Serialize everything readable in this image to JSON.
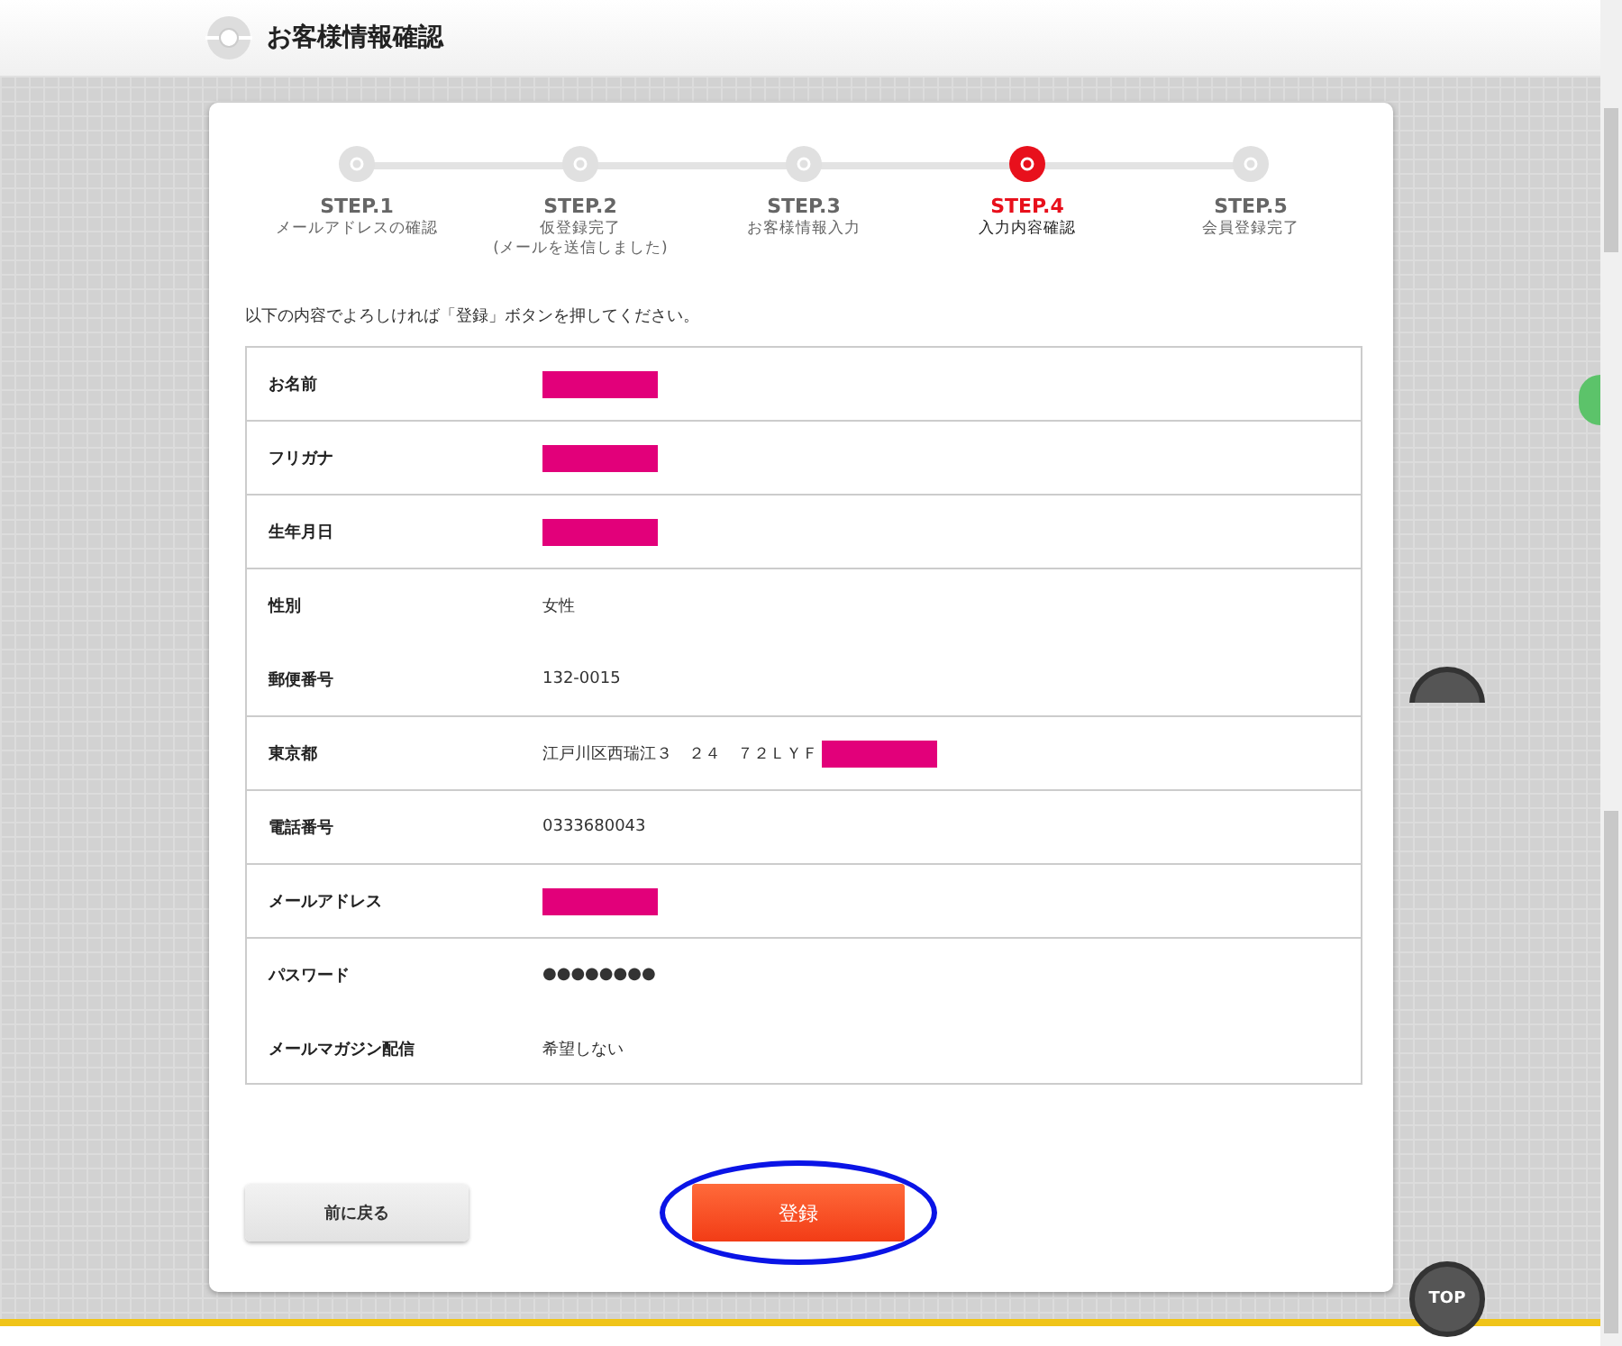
{
  "header": {
    "title": "お客様情報確認"
  },
  "steps": [
    {
      "label": "STEP.1",
      "caption": "メールアドレスの確認",
      "selected": false
    },
    {
      "label": "STEP.2",
      "caption": "仮登録完了\n(メールを送信しました)",
      "selected": false
    },
    {
      "label": "STEP.3",
      "caption": "お客様情報入力",
      "selected": false
    },
    {
      "label": "STEP.4",
      "caption": "入力内容確認",
      "selected": true
    },
    {
      "label": "STEP.5",
      "caption": "会員登録完了",
      "selected": false
    }
  ],
  "instruction": "以下の内容でよろしければ「登録」ボタンを押してください。",
  "rows": [
    {
      "label": "お名前",
      "redacted": true,
      "divider_below": true
    },
    {
      "label": "フリガナ",
      "redacted": true,
      "divider_below": true
    },
    {
      "label": "生年月日",
      "redacted": true,
      "divider_below": true
    },
    {
      "label": "性別",
      "value": "女性",
      "redacted": false,
      "divider_below": false
    },
    {
      "label": "郵便番号",
      "value": "132-0015",
      "redacted": false,
      "divider_below": true
    },
    {
      "label": "東京都",
      "value": "江戸川区西瑞江３　２４　７２ＬＹＦ",
      "redacted": true,
      "divider_below": true
    },
    {
      "label": "電話番号",
      "value": "0333680043",
      "redacted": false,
      "divider_below": true
    },
    {
      "label": "メールアドレス",
      "redacted": true,
      "divider_below": true
    },
    {
      "label": "パスワード",
      "value": "●●●●●●●●",
      "redacted": false,
      "divider_below": false
    },
    {
      "label": "メールマガジン配信",
      "value": "希望しない",
      "redacted": false
    }
  ],
  "buttons": {
    "back": "前に戻る",
    "submit": "登録"
  },
  "top_button": "TOP"
}
